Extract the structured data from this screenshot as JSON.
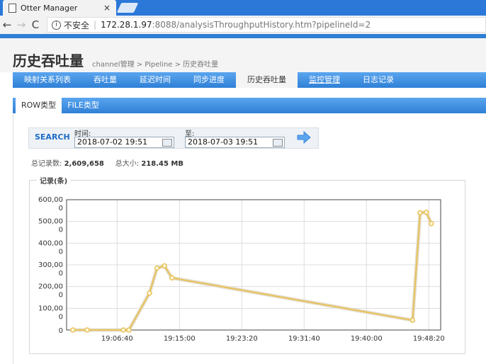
{
  "browser": {
    "tab_title": "Otter Manager",
    "close_glyph": "×",
    "insecure_label": "不安全",
    "url_host": "172.28.1.97",
    "url_path": ":8088/analysisThroughputHistory.htm?pipelineId=2"
  },
  "page": {
    "title": "历史吞吐量",
    "breadcrumb": "channel管理 > Pipeline > 历史吞吐量"
  },
  "nav": {
    "items": [
      "映射关系列表",
      "吞吐量",
      "延迟时间",
      "同步进度",
      "历史吞吐量",
      "监控管理",
      "日志记录"
    ],
    "active_index": 4,
    "underlined_index": 5
  },
  "subtabs": {
    "row": "ROW类型",
    "file": "FILE类型"
  },
  "search": {
    "button": "SEARCH",
    "from_label": "时间:",
    "from_value": "2018-07-02 19:51",
    "to_label": "至:",
    "to_value": "2018-07-03 19:51"
  },
  "stats": {
    "count_label": "总记录数:",
    "count_value": "2,609,658",
    "size_label": "总大小:",
    "size_value": "218.45 MB"
  },
  "chart_legend": "记录(条)",
  "colors": {
    "line": "#e8c15a",
    "accent": "#2f80d6",
    "point": "#fff7d6"
  },
  "chart_data": {
    "type": "line",
    "y_tick_labels": [
      [
        "600,00",
        "0"
      ],
      [
        "500,00",
        "0"
      ],
      [
        "400,00",
        "0"
      ],
      [
        "300,00",
        "0"
      ],
      [
        "200,00",
        "0"
      ],
      [
        "100,00",
        "0"
      ],
      [
        "0"
      ]
    ],
    "x_tick_labels": [
      "19:06:40",
      "19:15:00",
      "19:23:20",
      "19:31:40",
      "19:40:00",
      "19:48:20"
    ],
    "ylim": [
      0,
      6000000
    ],
    "grid": true,
    "series": [
      {
        "points": [
          [
            "19:00:45",
            0
          ],
          [
            "19:02:40",
            0
          ],
          [
            "19:07:30",
            0
          ],
          [
            "19:08:15",
            0
          ],
          [
            "19:11:00",
            1700000
          ],
          [
            "19:12:00",
            2850000
          ],
          [
            "19:13:00",
            2950000
          ],
          [
            "19:14:00",
            2400000
          ],
          [
            "19:46:10",
            450000
          ],
          [
            "19:47:10",
            5400000
          ],
          [
            "19:48:00",
            5420000
          ],
          [
            "19:48:40",
            4900000
          ]
        ]
      }
    ]
  }
}
